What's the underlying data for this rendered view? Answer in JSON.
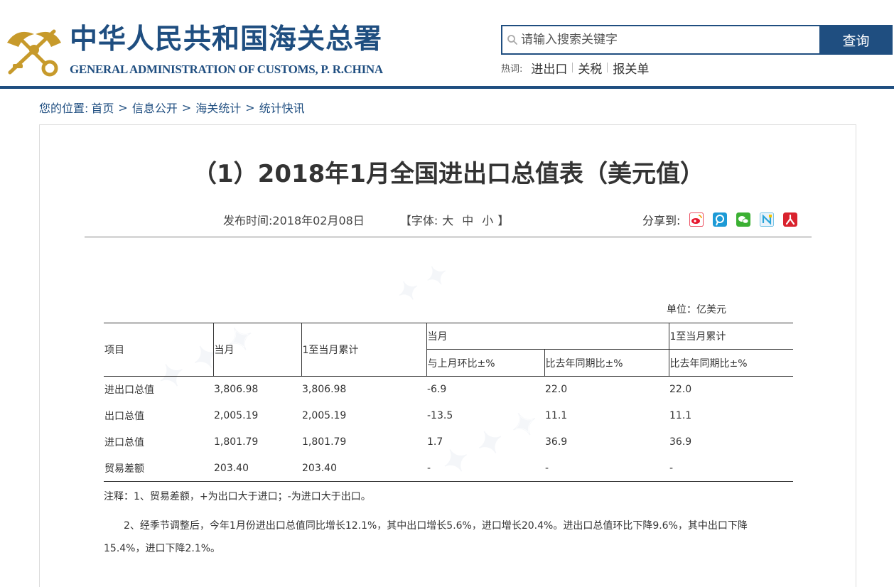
{
  "header": {
    "site_name_cn": "中华人民共和国海关总署",
    "site_name_en": "GENERAL ADMINISTRATION OF CUSTOMS, P. R.CHINA",
    "search": {
      "placeholder": "请输入搜索关键字",
      "button_label": "查询"
    },
    "hotwords": {
      "label": "热词:",
      "items": [
        "进出口",
        "关税",
        "报关单"
      ]
    }
  },
  "breadcrumb": {
    "prefix": "您的位置:",
    "items": [
      "首页",
      "信息公开",
      "海关统计",
      "统计快讯"
    ],
    "separator": ">"
  },
  "article": {
    "title": "（1）2018年1月全国进出口总值表（美元值）",
    "publish_label": "发布时间:",
    "publish_date": "2018年02月08日",
    "font_control": {
      "open": "【字体:",
      "large": "大",
      "medium": "中",
      "small": "小",
      "close": "】"
    },
    "share_label": "分享到:",
    "share_icons": [
      {
        "name": "weibo-icon",
        "color": "#e6162d"
      },
      {
        "name": "tencent-weibo-icon",
        "color": "#1c9ad6"
      },
      {
        "name": "wechat-icon",
        "color": "#3bb033"
      },
      {
        "name": "renren-icon",
        "color": "#2aa4d8"
      },
      {
        "name": "people-icon",
        "color": "#d9232e"
      }
    ],
    "unit": "单位：亿美元"
  },
  "table": {
    "headers": {
      "item": "项目",
      "current_month": "当月",
      "cumulative": "1至当月累计",
      "current_month_group": "当月",
      "cumulative_group": "1至当月累计",
      "mom": "与上月环比±%",
      "yoy_month": "比去年同期比±%",
      "yoy_cumulative": "比去年同期比±%"
    },
    "rows": [
      {
        "item": "进出口总值",
        "month": "3,806.98",
        "cumulative": "3,806.98",
        "mom": "-6.9",
        "yoy_month": "22.0",
        "yoy_cumulative": "22.0"
      },
      {
        "item": "出口总值",
        "month": "2,005.19",
        "cumulative": "2,005.19",
        "mom": "-13.5",
        "yoy_month": "11.1",
        "yoy_cumulative": "11.1"
      },
      {
        "item": "进口总值",
        "month": "1,801.79",
        "cumulative": "1,801.79",
        "mom": "1.7",
        "yoy_month": "36.9",
        "yoy_cumulative": "36.9"
      },
      {
        "item": "贸易差额",
        "month": "203.40",
        "cumulative": "203.40",
        "mom": "-",
        "yoy_month": "-",
        "yoy_cumulative": "-"
      }
    ]
  },
  "notes": {
    "note1": "注释：1、贸易差额，+为出口大于进口；-为进口大于出口。",
    "note2": "2、经季节调整后，今年1月份进出口总值同比增长12.1%，其中出口增长5.6%，进口增长20.4%。进出口总值环比下降9.6%，其中出口下降15.4%，进口下降2.1%。"
  }
}
